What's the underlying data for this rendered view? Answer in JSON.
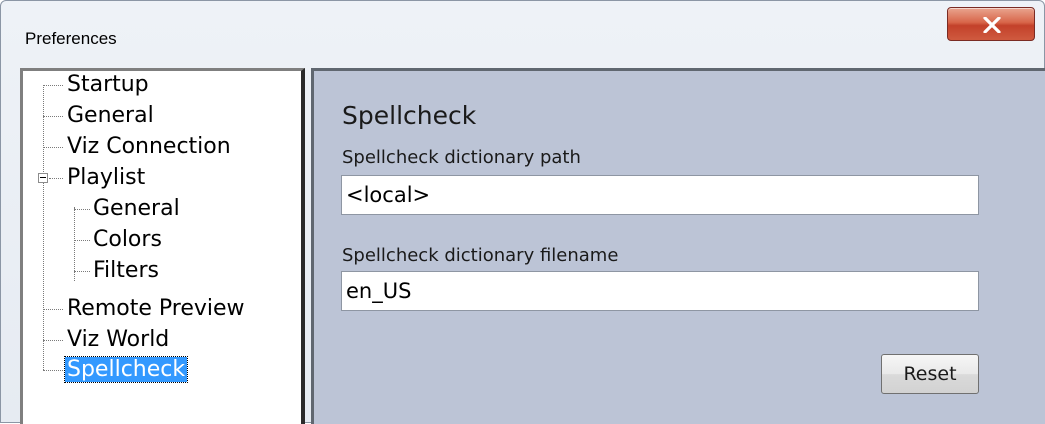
{
  "window": {
    "title": "Preferences",
    "close_icon": "close-x-icon"
  },
  "tree": {
    "items": [
      {
        "label": "Startup"
      },
      {
        "label": "General"
      },
      {
        "label": "Viz Connection"
      },
      {
        "label": "Playlist",
        "expanded": true
      },
      {
        "label": "General"
      },
      {
        "label": "Colors"
      },
      {
        "label": "Filters"
      },
      {
        "label": "Remote Preview"
      },
      {
        "label": "Viz World"
      },
      {
        "label": "Spellcheck",
        "selected": true
      }
    ]
  },
  "panel": {
    "title": "Spellcheck",
    "path_label": "Spellcheck dictionary path",
    "path_value": "<local>",
    "filename_label": "Spellcheck dictionary filename",
    "filename_value": "en_US",
    "reset_label": "Reset"
  },
  "colors": {
    "panel_background": "#bcc4d6",
    "selection": "#3399ff",
    "close_button": "#c3412a"
  }
}
